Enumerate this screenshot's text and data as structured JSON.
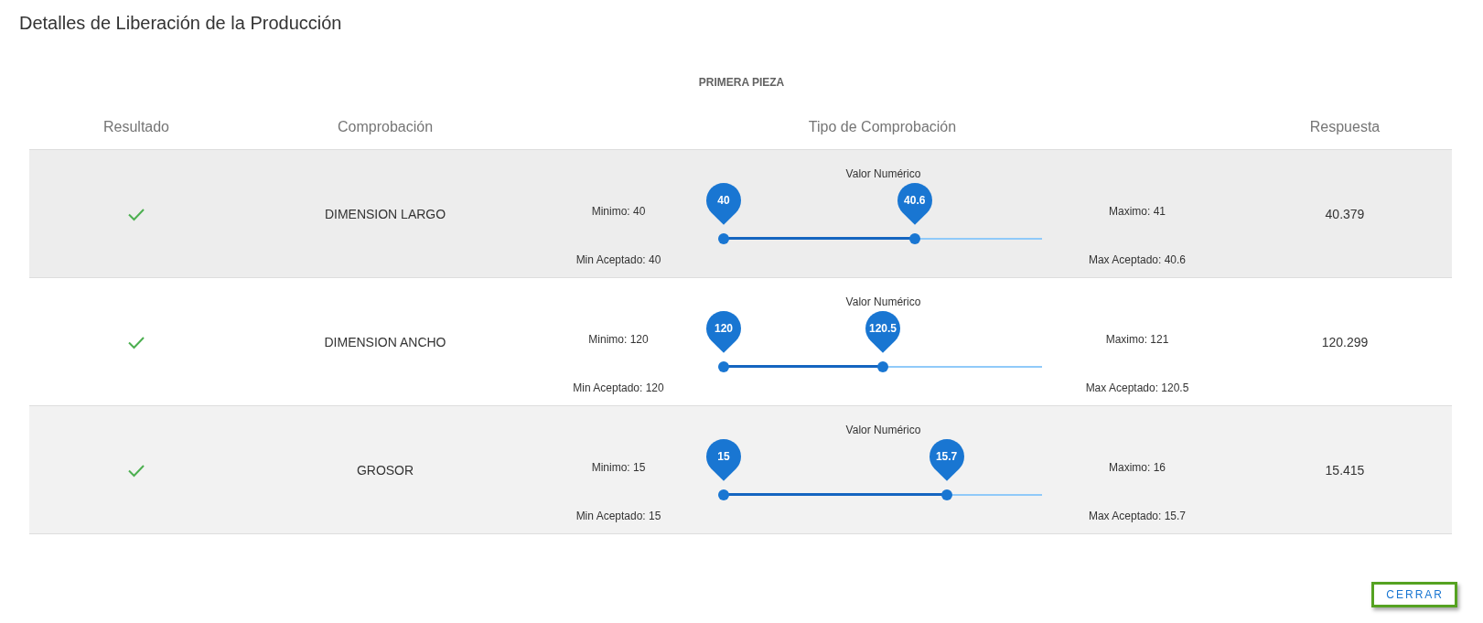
{
  "title": "Detalles de Liberación de la Producción",
  "section": "PRIMERA PIEZA",
  "columns": [
    "Resultado",
    "Comprobación",
    "Tipo de Comprobación",
    "Respuesta"
  ],
  "rows": [
    {
      "passed": true,
      "check": "DIMENSION LARGO",
      "type_label": "Valor Numérico",
      "minimum": "Minimo: 40",
      "maximum": "Maximo: 41",
      "min_accepted": "Min Aceptado: 40",
      "max_accepted": "Max Aceptado: 40.6",
      "thumbs": [
        {
          "label": "40",
          "level": 0
        },
        {
          "label": "40.6",
          "level": 0.6
        }
      ],
      "answer": "40.379"
    },
    {
      "passed": true,
      "check": "DIMENSION ANCHO",
      "type_label": "Valor Numérico",
      "minimum": "Minimo: 120",
      "maximum": "Maximo: 121",
      "min_accepted": "Min Aceptado: 120",
      "max_accepted": "Max Aceptado: 120.5",
      "thumbs": [
        {
          "label": "120",
          "level": 0
        },
        {
          "label": "120.5",
          "level": 0.5
        }
      ],
      "answer": "120.299"
    },
    {
      "passed": true,
      "check": "GROSOR",
      "type_label": "Valor Numérico",
      "minimum": "Minimo: 15",
      "maximum": "Maximo: 16",
      "min_accepted": "Min Aceptado: 15",
      "max_accepted": "Max Aceptado: 15.7",
      "thumbs": [
        {
          "label": "15",
          "level": 0
        },
        {
          "label": "15.7",
          "level": 0.7
        }
      ],
      "answer": "15.415"
    }
  ],
  "buttons": [
    "CERRAR"
  ]
}
